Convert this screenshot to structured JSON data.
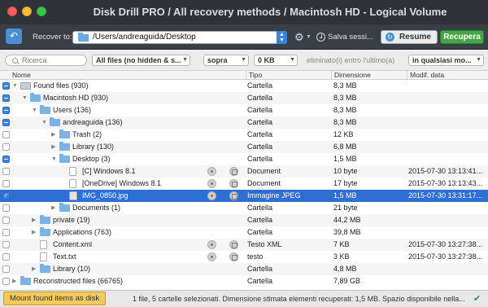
{
  "window": {
    "title": "Disk Drill PRO / All recovery methods / Macintosh HD - Logical Volume"
  },
  "toolbar": {
    "recover_label": "Recover to:",
    "path": "/Users/andreaguida/Desktop",
    "save_label": "Salva sessi...",
    "resume_label": "Resume",
    "recupera_label": "Recupera"
  },
  "filters": {
    "search_placeholder": "Ricerca",
    "file_filter": "All files (no hidden & s...",
    "size_op": "sopra",
    "size_value": "0 KB",
    "age_label": "eliminato(i) entro l'ultimo(a)",
    "age_value": "in qualsiasi mo..."
  },
  "columns": {
    "name": "Nome",
    "type": "Tipo",
    "size": "Dimensione",
    "modified": "Modif. data"
  },
  "rows": [
    {
      "name": "Found files (930)",
      "type": "Cartella",
      "size": "8,3 MB",
      "date": "",
      "check": "mixed",
      "depth": 0,
      "expand": "open",
      "icon": "drive-icon",
      "actions": false,
      "selected": false
    },
    {
      "name": "Macintosh HD (930)",
      "type": "Cartella",
      "size": "8,3 MB",
      "date": "",
      "check": "mixed",
      "depth": 1,
      "expand": "open",
      "icon": "folder-icon",
      "actions": false,
      "selected": false
    },
    {
      "name": "Users (136)",
      "type": "Cartella",
      "size": "8,3 MB",
      "date": "",
      "check": "mixed",
      "depth": 2,
      "expand": "open",
      "icon": "folder-icon",
      "actions": false,
      "selected": false
    },
    {
      "name": "andreaguida (136)",
      "type": "Cartella",
      "size": "8,3 MB",
      "date": "",
      "check": "mixed",
      "depth": 3,
      "expand": "open",
      "icon": "folder-icon",
      "actions": false,
      "selected": false
    },
    {
      "name": "Trash (2)",
      "type": "Cartella",
      "size": "12 KB",
      "date": "",
      "check": "none",
      "depth": 4,
      "expand": "closed",
      "icon": "folder-icon",
      "actions": false,
      "selected": false
    },
    {
      "name": "Library (130)",
      "type": "Cartella",
      "size": "6,8 MB",
      "date": "",
      "check": "none",
      "depth": 4,
      "expand": "closed",
      "icon": "folder-icon",
      "actions": false,
      "selected": false
    },
    {
      "name": "Desktop (3)",
      "type": "Cartella",
      "size": "1,5 MB",
      "date": "",
      "check": "mixed",
      "depth": 4,
      "expand": "open",
      "icon": "folder-icon",
      "actions": false,
      "selected": false
    },
    {
      "name": "[C] Windows 8.1",
      "type": "Document",
      "size": "10 byte",
      "date": "2015-07-30 13:13:41...",
      "check": "none",
      "depth": 5,
      "expand": "none",
      "icon": "document-icon",
      "actions": true,
      "selected": false
    },
    {
      "name": "[OneDrive] Windows 8.1",
      "type": "Document",
      "size": "17 byte",
      "date": "2015-07-30 13:13:43...",
      "check": "none",
      "depth": 5,
      "expand": "none",
      "icon": "document-icon",
      "actions": true,
      "selected": false
    },
    {
      "name": "IMG_0850.jpg",
      "type": "Immagine JPEG",
      "size": "1,5 MB",
      "date": "2015-07-30 13:31:17...",
      "check": "checked",
      "depth": 5,
      "expand": "none",
      "icon": "image-icon",
      "actions": true,
      "selected": true
    },
    {
      "name": "Documents (1)",
      "type": "Cartella",
      "size": "21 byte",
      "date": "",
      "check": "none",
      "depth": 4,
      "expand": "closed",
      "icon": "folder-icon",
      "actions": false,
      "selected": false
    },
    {
      "name": "private (19)",
      "type": "Cartella",
      "size": "44,2 MB",
      "date": "",
      "check": "none",
      "depth": 2,
      "expand": "closed",
      "icon": "folder-icon",
      "actions": false,
      "selected": false
    },
    {
      "name": "Applications (763)",
      "type": "Cartella",
      "size": "39,8 MB",
      "date": "",
      "check": "none",
      "depth": 2,
      "expand": "closed",
      "icon": "folder-icon",
      "actions": false,
      "selected": false
    },
    {
      "name": "Content.xml",
      "type": "Testo XML",
      "size": "7 KB",
      "date": "2015-07-30 13:27:38...",
      "check": "none",
      "depth": 2,
      "expand": "none",
      "icon": "document-icon",
      "actions": true,
      "selected": false
    },
    {
      "name": "Text.txt",
      "type": "testo",
      "size": "3 KB",
      "date": "2015-07-30 13:27:38...",
      "check": "none",
      "depth": 2,
      "expand": "none",
      "icon": "document-icon",
      "actions": true,
      "selected": false
    },
    {
      "name": "Library (10)",
      "type": "Cartella",
      "size": "4,8 MB",
      "date": "",
      "check": "none",
      "depth": 2,
      "expand": "closed",
      "icon": "folder-icon",
      "actions": false,
      "selected": false
    },
    {
      "name": "Reconstructed files (66765)",
      "type": "Cartella",
      "size": "7,89 GB",
      "date": "",
      "check": "none",
      "depth": 0,
      "expand": "closed",
      "icon": "folder-icon",
      "actions": false,
      "selected": false
    }
  ],
  "statusbar": {
    "mount_label": "Mount found items as disk",
    "text": "1 file, 5 cartelle selezionati. Dimensione stimata elementi recuperati: 1,5 MB. Spazio disponibile nella..."
  }
}
